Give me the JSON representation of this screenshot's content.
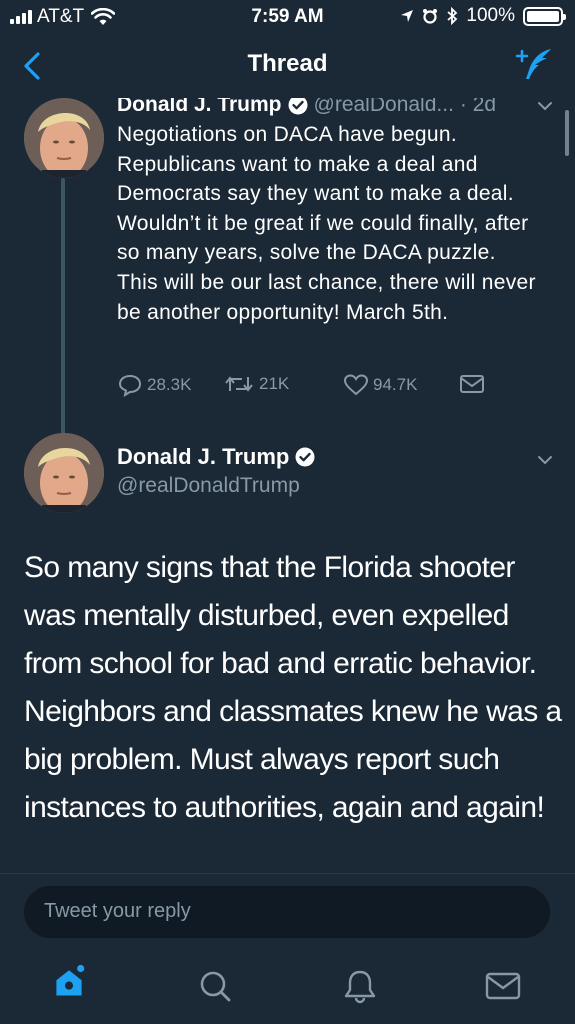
{
  "status_bar": {
    "carrier": "AT&T",
    "time": "7:59 AM",
    "battery": "100%"
  },
  "nav": {
    "title": "Thread",
    "back_icon": "chevron-left-icon",
    "compose_icon": "compose-tweet-icon"
  },
  "tweets": [
    {
      "name": "Donald J. Trump",
      "handle": "@realDonald...",
      "age": "· 2d",
      "text": "Negotiations on DACA have begun. Republicans want to make a deal and Democrats say they want to make a deal. Wouldn’t it be great if we could finally, after so many years, solve the DACA puzzle. This will be our last chance, there will never be another opportunity! March 5th.",
      "replies": "28.3K",
      "retweets": "21K",
      "likes": "94.7K"
    },
    {
      "name": "Donald J. Trump",
      "handle": "@realDonaldTrump",
      "text": "So many signs that the Florida shooter was mentally disturbed, even expelled from school for bad and erratic behavior. Neighbors and classmates knew he was a big problem. Must always report such instances to authorities, again and again!"
    }
  ],
  "reply": {
    "placeholder": "Tweet your reply"
  },
  "tabbar": [
    "home-icon",
    "search-icon",
    "notifications-icon",
    "messages-icon"
  ],
  "colors": {
    "background": "#1b2836",
    "accent": "#1da1f2",
    "secondary_text": "#8899a6"
  }
}
